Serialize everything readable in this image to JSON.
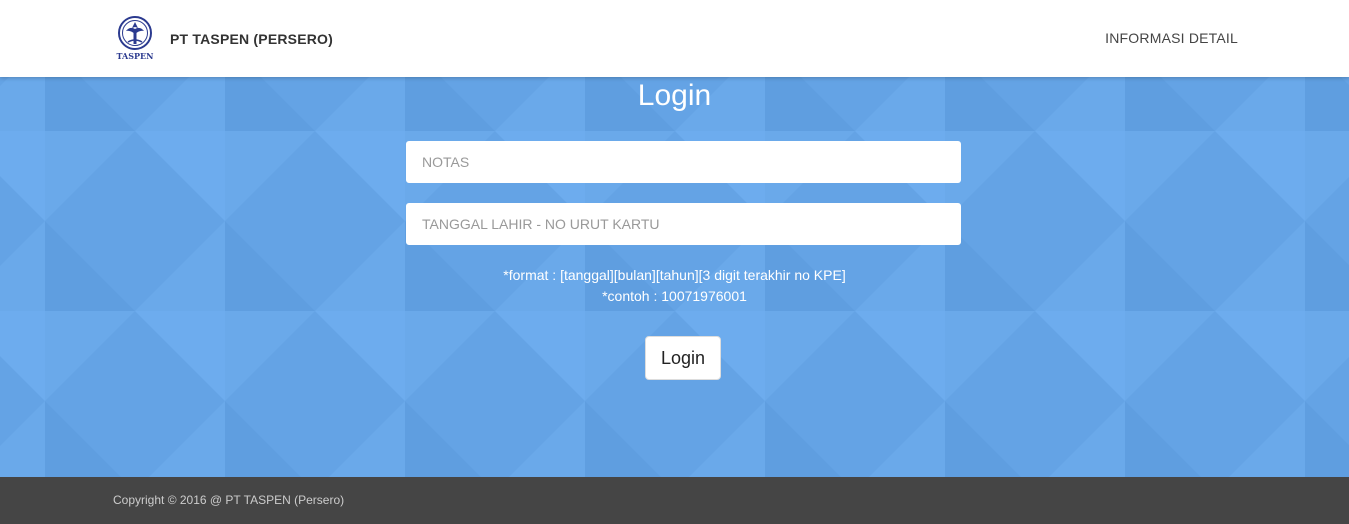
{
  "header": {
    "brand_name": "PT TASPEN (PERSERO)",
    "logo_text": "TASPEN",
    "logo_icon": "taspen-logo",
    "nav_link": "INFORMASI DETAIL"
  },
  "login": {
    "title": "Login",
    "notas": {
      "value": "",
      "placeholder": "NOTAS"
    },
    "tanggal_lahir": {
      "value": "",
      "placeholder": "TANGGAL LAHIR - NO URUT KARTU"
    },
    "format_hint": "*format : [tanggal][bulan][tahun][3 digit terakhir no KPE]",
    "example_hint": "*contoh : 10071976001",
    "button_label": "Login"
  },
  "footer": {
    "copyright": "Copyright © 2016 @ PT TASPEN (Persero)"
  },
  "colors": {
    "hero_bg": "#64a3e5",
    "footer_bg": "#454545",
    "logo_blue": "#2b3a8f"
  }
}
